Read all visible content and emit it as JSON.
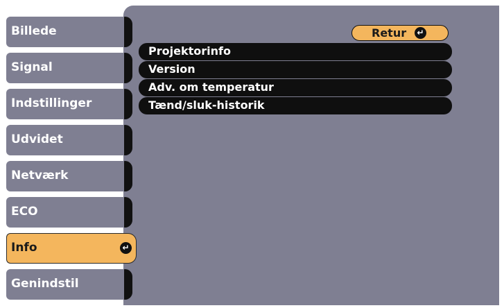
{
  "sidebar": {
    "items": [
      {
        "label": "Billede"
      },
      {
        "label": "Signal"
      },
      {
        "label": "Indstillinger"
      },
      {
        "label": "Udvidet"
      },
      {
        "label": "Netværk"
      },
      {
        "label": "ECO"
      },
      {
        "label": "Info",
        "selected": true
      },
      {
        "label": "Genindstil"
      }
    ]
  },
  "main": {
    "return_label": "Retur",
    "items": [
      {
        "label": "Projektorinfo"
      },
      {
        "label": "Version"
      },
      {
        "label": "Adv. om temperatur"
      },
      {
        "label": "Tænd/sluk-historik"
      }
    ]
  },
  "icons": {
    "enter": "enter-icon"
  },
  "colors": {
    "tab": "#7f7f92",
    "active": "#f4b65d",
    "panel": "#7f7f92",
    "item_bg": "#0f0f0f"
  }
}
